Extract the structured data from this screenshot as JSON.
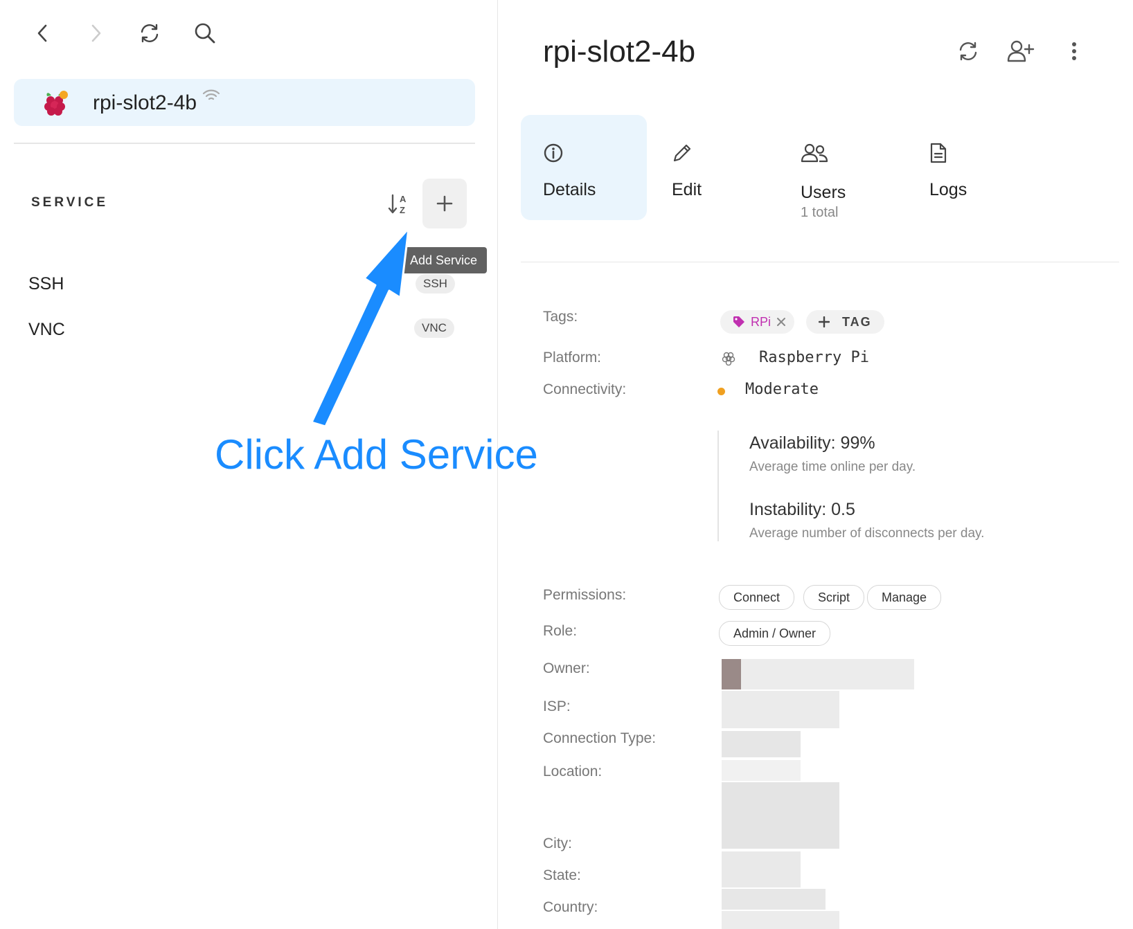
{
  "nav": {
    "back_icon": "chevron-left-icon",
    "forward_icon": "chevron-right-icon",
    "refresh_icon": "refresh-icon",
    "search_icon": "search-icon"
  },
  "device": {
    "name": "rpi-slot2-4b",
    "icon": "raspberry-pi-icon",
    "status_icon": "wifi-icon"
  },
  "services": {
    "section_title": "SERVICE",
    "sort_icon": "sort-az-icon",
    "add_icon": "plus-icon",
    "add_tooltip": "Add Service",
    "items": [
      {
        "name": "SSH",
        "chip": "SSH"
      },
      {
        "name": "VNC",
        "chip": "VNC"
      }
    ]
  },
  "header": {
    "title": "rpi-slot2-4b",
    "actions": [
      "refresh-icon",
      "add-user-icon",
      "more-vertical-icon"
    ]
  },
  "tabs": [
    {
      "label": "Details",
      "icon": "info-icon",
      "sub": "",
      "active": true
    },
    {
      "label": "Edit",
      "icon": "pencil-icon",
      "sub": ""
    },
    {
      "label": "Users",
      "icon": "users-icon",
      "sub": "1 total"
    },
    {
      "label": "Logs",
      "icon": "document-icon",
      "sub": ""
    }
  ],
  "details": {
    "tags_label": "Tags:",
    "tag": "RPi",
    "add_tag": "TAG",
    "platform_label": "Platform:",
    "platform": "Raspberry Pi",
    "connectivity_label": "Connectivity:",
    "connectivity": "Moderate",
    "connectivity_color": "#f0a020",
    "availability_title": "Availability: 99%",
    "availability_desc": "Average time online per day.",
    "instability_title": "Instability: 0.5",
    "instability_desc": "Average number of disconnects per day.",
    "permissions_label": "Permissions:",
    "permissions": [
      "Connect",
      "Script",
      "Manage"
    ],
    "role_label": "Role:",
    "role": "Admin / Owner",
    "owner_label": "Owner:",
    "isp_label": "ISP:",
    "connection_type_label": "Connection Type:",
    "location_label": "Location:",
    "city_label": "City:",
    "state_label": "State:",
    "country_label": "Country:"
  },
  "annotation": {
    "text": "Click Add Service",
    "color": "#1a8cff"
  },
  "colors": {
    "accent": "#1a8cff",
    "active_bg": "#eaf5fd",
    "tag": "#c030b0"
  }
}
